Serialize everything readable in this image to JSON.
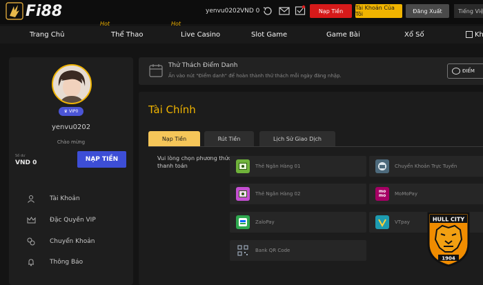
{
  "header": {
    "logo_text": "Fi88",
    "username": "yenvu0202",
    "balance": "VND 0",
    "deposit_label": "Nạp Tiền",
    "account_label": "Tài Khoản Của Tôi",
    "logout_label": "Đăng Xuất",
    "language_label": "Tiếng Việt"
  },
  "nav": {
    "hot_tag": "Hot",
    "items": [
      {
        "label": "Trang Chủ"
      },
      {
        "label": "Thể Thao"
      },
      {
        "label": "Live Casino"
      },
      {
        "label": "Slot Game"
      },
      {
        "label": "Game Bài"
      },
      {
        "label": "Xổ Số"
      },
      {
        "label": "Kh"
      }
    ]
  },
  "profile": {
    "vip_label": "VIP0",
    "username": "yenvu0202",
    "welcome": "Chào mừng",
    "balance_label": "Số dư",
    "balance": "VND 0",
    "deposit_button": "NẠP TIỀN",
    "menu": [
      {
        "label": "Tài Khoản",
        "icon": "user-icon"
      },
      {
        "label": "Đặc Quyền VIP",
        "icon": "crown-icon"
      },
      {
        "label": "Chuyển Khoản",
        "icon": "transfer-icon"
      },
      {
        "label": "Thông Báo",
        "icon": "bell-icon"
      }
    ]
  },
  "challenge": {
    "title": "Thử Thách Điểm Danh",
    "subtitle": "Ấn vào nút \"Điểm danh\" để hoàn thành thử thách mỗi ngày đăng nhập.",
    "button_label": "ĐIỂM"
  },
  "finance": {
    "title": "Tài Chính",
    "tabs": [
      {
        "label": "Nạp Tiền",
        "active": true
      },
      {
        "label": "Rút Tiền",
        "active": false
      },
      {
        "label": "Lịch Sử Giao Dịch",
        "active": false
      }
    ],
    "choose_text": "Vui lòng chọn phương thức thanh toán",
    "methods": [
      {
        "label": "Thẻ Ngân Hàng 01",
        "icon": "bank-card-icon",
        "color": "#6fb23a"
      },
      {
        "label": "Chuyển Khoản Trực Tuyến",
        "icon": "globe-transfer-icon",
        "color": "#4d6a7c"
      },
      {
        "label": "Thẻ Ngân Hàng 02",
        "icon": "bank-card-icon",
        "color": "#c44fd1"
      },
      {
        "label": "MoMoPay",
        "icon": "momo-icon",
        "color": "#a50064"
      },
      {
        "label": "ZaloPay",
        "icon": "zalopay-icon",
        "color": "#2fa84f"
      },
      {
        "label": "VTpay",
        "icon": "vtpay-icon",
        "color": "#1d9bb0"
      },
      {
        "label": "Bank QR Code",
        "icon": "qr-code-icon",
        "color": "#3a3a3a"
      }
    ]
  },
  "badge": {
    "name": "HULL CITY",
    "year": "1904"
  }
}
